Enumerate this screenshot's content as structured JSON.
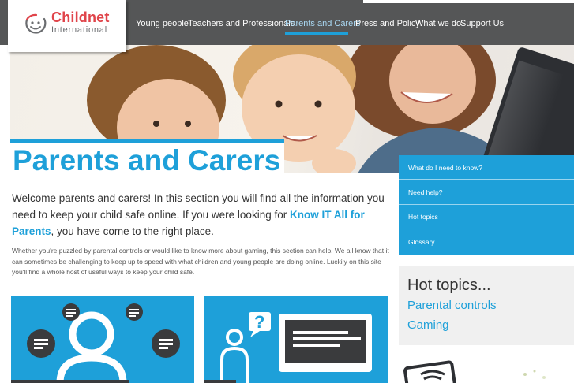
{
  "logo": {
    "name": "Childnet",
    "subtitle": "International"
  },
  "nav": {
    "items": [
      {
        "label": "Young people"
      },
      {
        "label": "Teachers and Professionals"
      },
      {
        "label": "Parents and Carers",
        "active": true
      },
      {
        "label": "Press and Policy"
      },
      {
        "label": "What we do"
      },
      {
        "label": "Support Us"
      }
    ]
  },
  "hero": {
    "image_description_icon": "hero-photo"
  },
  "page": {
    "title": "Parents and Carers",
    "intro_before": "Welcome parents and carers! In this section you will find all the information you need to keep your child safe online. If you were looking for ",
    "intro_link": "Know IT All for Parents",
    "intro_after": ", you have come to the right place.",
    "body": "Whether you're puzzled by parental controls or would like to know more about gaming, this section can help. We all know that it can sometimes be challenging to keep up to speed with what children and young people are doing online. Luckily on this site you'll find a whole host of useful ways to keep your child safe."
  },
  "side_menu": {
    "items": [
      {
        "label": "What do I need to know?"
      },
      {
        "label": "Need help?"
      },
      {
        "label": "Hot topics"
      },
      {
        "label": "Glossary"
      }
    ]
  },
  "hot_topics": {
    "title": "Hot topics...",
    "links": [
      {
        "label": "Parental controls"
      },
      {
        "label": "Gaming"
      }
    ]
  },
  "colors": {
    "accent": "#1ea0d9",
    "nav_bg": "#555657",
    "logo_red": "#e0444a"
  }
}
